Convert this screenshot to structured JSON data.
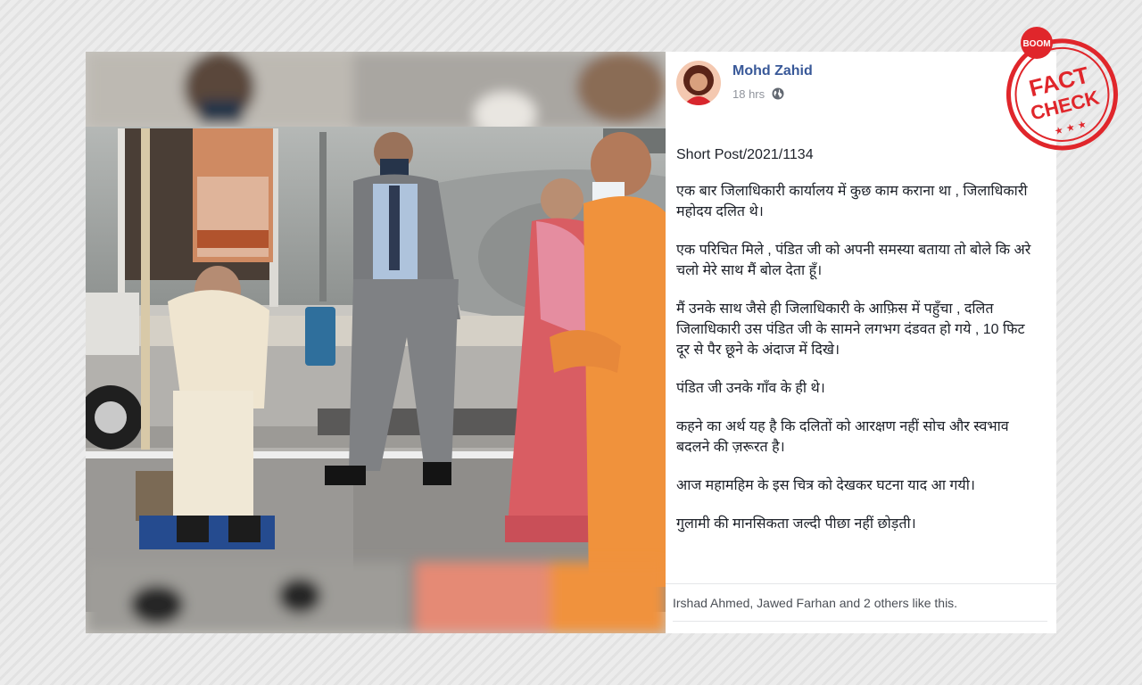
{
  "post": {
    "author": "Mohd Zahid",
    "time": "18 hrs",
    "privacy_icon": "globe-icon",
    "paragraphs": [
      "Short Post/2021/1134",
      "एक बार जिलाधिकारी कार्यालय में कुछ काम कराना था , जिलाधिकारी महोदय दलित थे।",
      "एक परिचित मिले , पंडित जी को अपनी समस्या बताया तो बोले कि अरे चलो मेरे साथ मैं बोल देता हूँ।",
      "मैं उनके साथ जैसे ही जिलाधिकारी के आफ़िस में पहुँचा , दलित जिलाधिकारी उस पंडित जी के सामने लगभग दंडवत हो गये , 10 फिट दूर से पैर छूने के अंदाज में दिखे।",
      "पंडित जी उनके गाँव के ही थे।",
      "कहने का अर्थ यह है कि दलितों को आरक्षण नहीं सोच और स्वभाव बदलने की ज़रूरत है।",
      "आज महामहिम के इस चित्र को देखकर घटना याद आ गयी।",
      "गुलामी की मानसिकता जल्दी पीछा नहीं छोड़ती।"
    ],
    "likes_text": "Irshad Ahmed, Jawed Farhan and 2 others like this."
  },
  "stamp": {
    "brand": "BOOM",
    "line1": "FACT",
    "line2": "CHECK",
    "color": "#e0262b"
  },
  "colors": {
    "author_link": "#385898",
    "background": "#e9e9e9",
    "card": "#ffffff"
  }
}
